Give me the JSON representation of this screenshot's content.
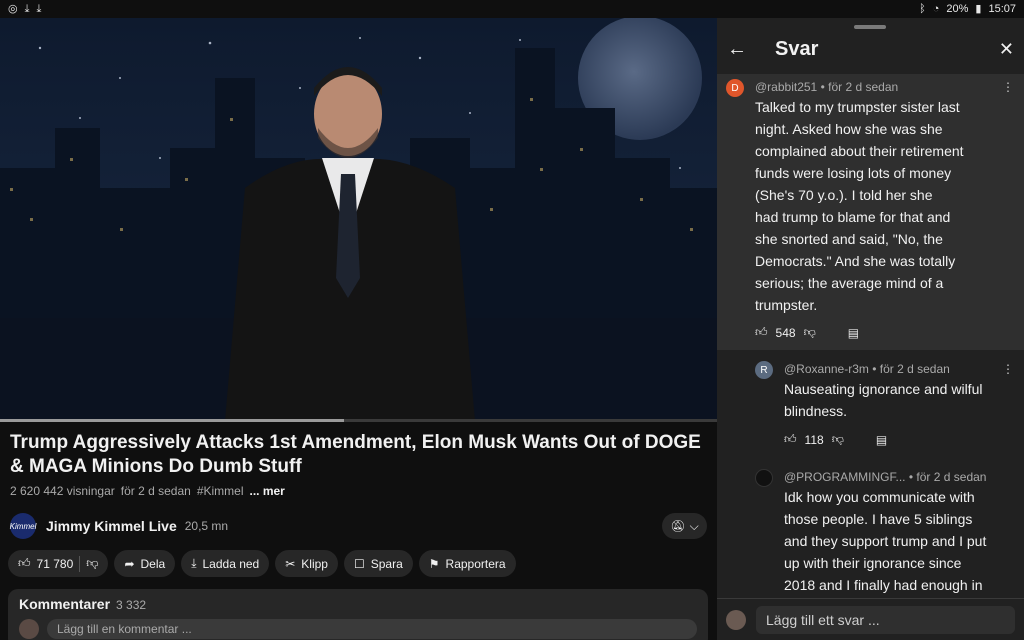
{
  "status_bar": {
    "left_icons": [
      "sync-icon",
      "download-icon",
      "download-icon"
    ],
    "battery": "20%",
    "time": "15:07"
  },
  "video": {
    "progress_fraction": 0.48
  },
  "title": "Trump Aggressively Attacks 1st Amendment, Elon Musk Wants Out of DOGE & MAGA Minions Do Dumb Stuff",
  "meta": {
    "views": "2 620 442 visningar",
    "age": "för 2 d sedan",
    "hashtag": "#Kimmel",
    "more": "... mer"
  },
  "channel": {
    "avatar_text": "Kimmel",
    "name": "Jimmy Kimmel Live",
    "subscribers": "20,5 mn"
  },
  "actions": {
    "likes": "71 780",
    "share": "Dela",
    "download": "Ladda ned",
    "clip": "Klipp",
    "save": "Spara",
    "report": "Rapportera"
  },
  "comments": {
    "title": "Kommentarer",
    "count": "3 332",
    "add_placeholder": "Lägg till en kommentar ..."
  },
  "panel": {
    "title": "Svar",
    "parent": {
      "avatar_letter": "D",
      "avatar_color": "#e0562b",
      "author": "@rabbit251",
      "age": "• för 2 d sedan",
      "lines": [
        "Talked to my trumpster sister last",
        "night. Asked how she was she",
        "complained about their retirement",
        "funds were losing lots of money",
        "(She's 70 y.o.). I told her she",
        "had trump to blame for that and",
        "she snorted and said, \"No, the",
        "Democrats.\" And she was totally",
        "serious; the average mind of a",
        "trumpster."
      ],
      "likes": "548"
    },
    "replies": [
      {
        "avatar_letter": "R",
        "avatar_color": "#5b6b80",
        "author": "@Roxanne-r3m",
        "age": "• för 2 d sedan",
        "lines": [
          "Nauseating ignorance and wilful",
          "blindness."
        ],
        "likes": "118"
      },
      {
        "avatar_letter": "",
        "avatar_color": "#111111",
        "author": "@PROGRAMMINGF...",
        "age": "• för 2 d sedan",
        "lines": [
          "Idk how you communicate with",
          "those people. I have 5 siblings",
          "and they support trump and I put",
          "up with their ignorance since",
          "2018 and I finally had enough in"
        ],
        "likes": ""
      }
    ],
    "reply_placeholder": "Lägg till ett svar ..."
  }
}
